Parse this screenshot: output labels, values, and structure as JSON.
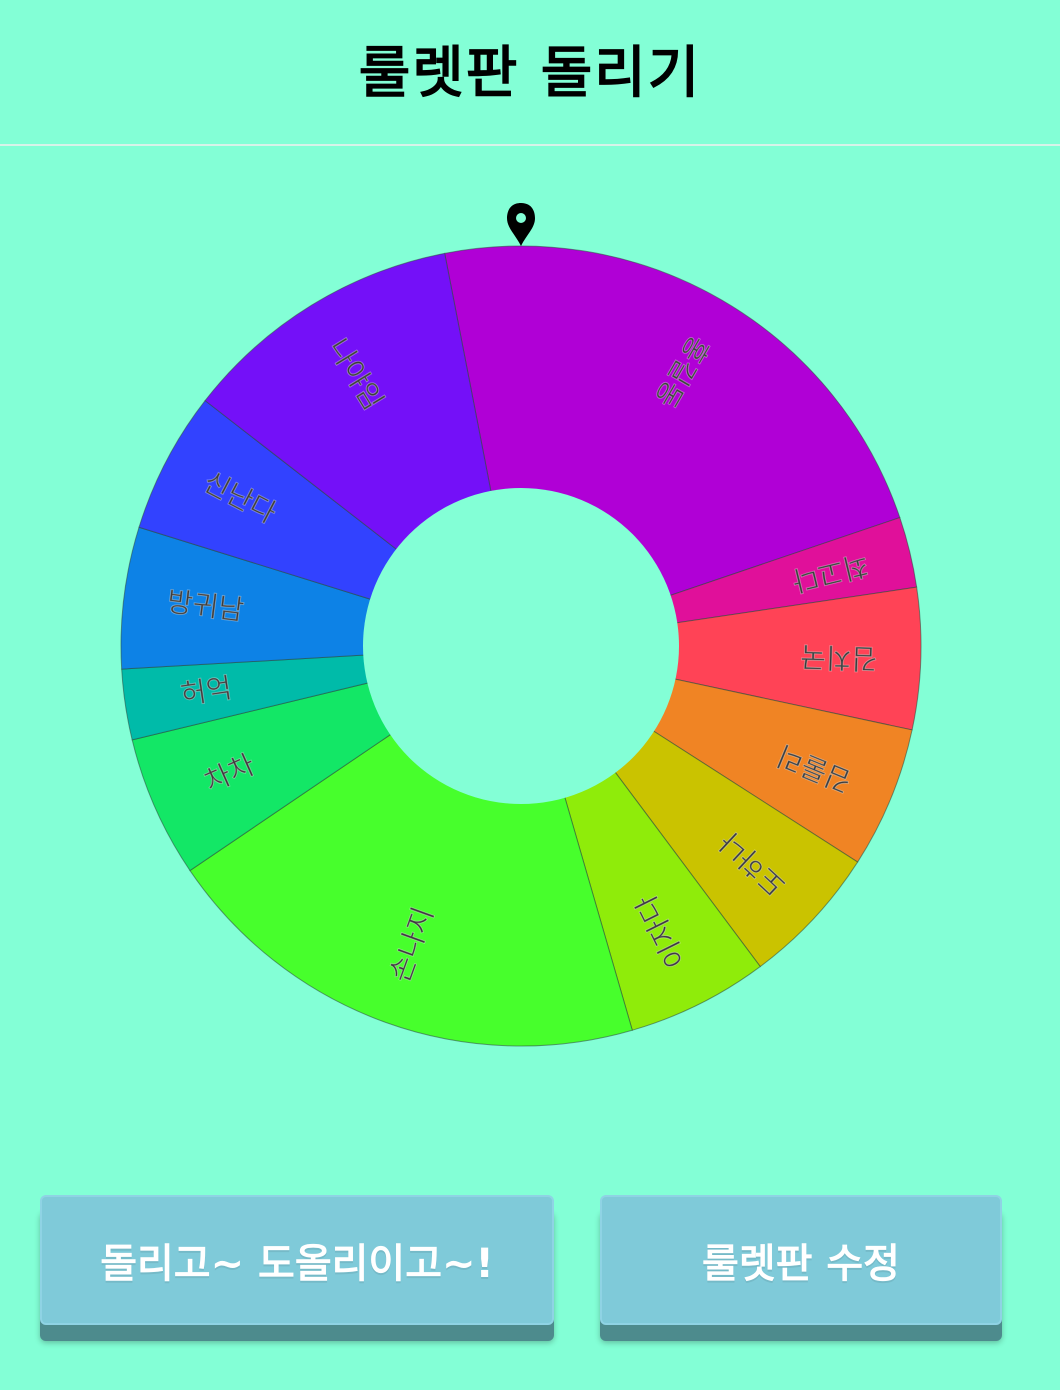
{
  "header": {
    "title": "룰렛판 돌리기"
  },
  "wheel": {
    "pointer_icon": "map-pin-icon",
    "segments": [
      {
        "label": "홍길동",
        "color": "#b000d6",
        "weight": 0.2051
      },
      {
        "label": "최고다",
        "color": "#e0109a",
        "weight": 0.0256
      },
      {
        "label": "김치국",
        "color": "#ff4356",
        "weight": 0.0513
      },
      {
        "label": "김룰리",
        "color": "#f08424",
        "weight": 0.0513
      },
      {
        "label": "도하나",
        "color": "#cac300",
        "weight": 0.0513
      },
      {
        "label": "이자다",
        "color": "#8fec0a",
        "weight": 0.0513
      },
      {
        "label": "손나지",
        "color": "#47ff2c",
        "weight": 0.1795
      },
      {
        "label": "차차",
        "color": "#13e766",
        "weight": 0.0513
      },
      {
        "label": "허억",
        "color": "#00bba9",
        "weight": 0.0256
      },
      {
        "label": "방귀남",
        "color": "#0d82e6",
        "weight": 0.0513
      },
      {
        "label": "신난다",
        "color": "#3242ff",
        "weight": 0.0513
      },
      {
        "label": "나야임",
        "color": "#7410f8",
        "weight": 0.1026
      }
    ]
  },
  "buttons": {
    "spin_label": "돌리고~ 도올리이고~!",
    "edit_label": "룰렛판 수정"
  }
}
